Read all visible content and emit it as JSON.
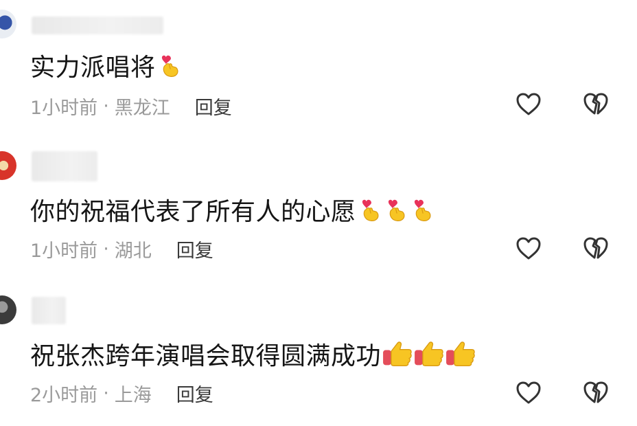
{
  "comments": [
    {
      "text": "实力派唱将",
      "time": "1小时前",
      "separator": "·",
      "location": "黑龙江",
      "reply_label": "回复",
      "emojis": [
        "finger-heart-icon"
      ]
    },
    {
      "text": "你的祝福代表了所有人的心愿",
      "time": "1小时前",
      "separator": "·",
      "location": "湖北",
      "reply_label": "回复",
      "emojis": [
        "finger-heart-icon",
        "finger-heart-icon",
        "finger-heart-icon"
      ]
    },
    {
      "text": "祝张杰跨年演唱会取得圆满成功",
      "time": "2小时前",
      "separator": "·",
      "location": "上海",
      "reply_label": "回复",
      "emojis": [
        "thumbs-up-icon",
        "thumbs-up-icon",
        "thumbs-up-icon"
      ]
    }
  ],
  "colors": {
    "text": "#151515",
    "meta": "#9a9a9a",
    "icon_stroke": "#333333",
    "emoji_yellow": "#f7c523",
    "emoji_heart": "#e8325a"
  }
}
